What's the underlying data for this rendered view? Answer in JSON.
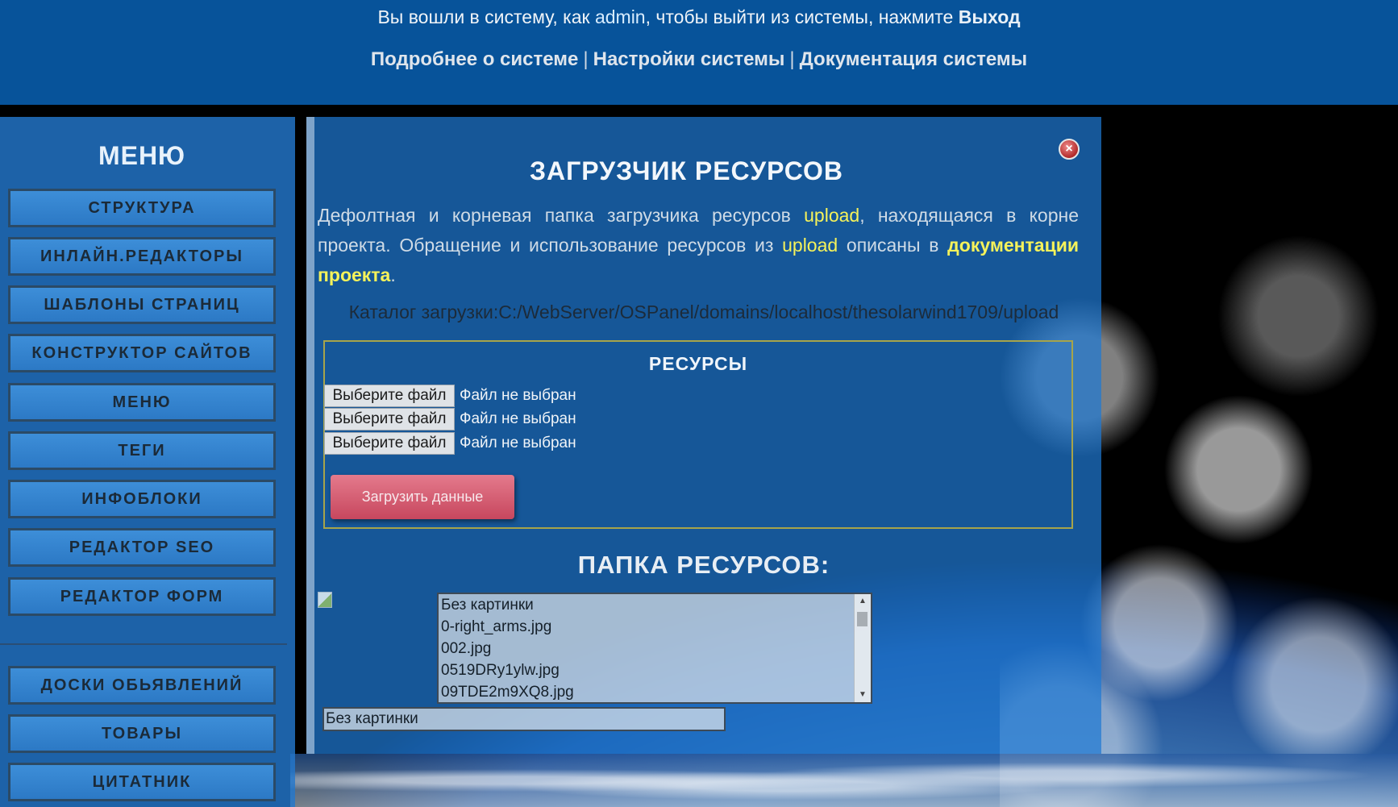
{
  "header": {
    "login_prefix": "Вы вошли в систему, как ",
    "user": "admin",
    "login_middle": ", чтобы выйти из системы, нажмите ",
    "exit_label": "Выход",
    "links": [
      "Подробнее о системе",
      "Настройки системы",
      "Документация системы"
    ],
    "separator": "|"
  },
  "sidebar": {
    "title": "МЕНЮ",
    "items": [
      "СТРУКТУРА",
      "ИНЛАЙН.РЕДАКТОРЫ",
      "ШАБЛОНЫ СТРАНИЦ",
      "КОНСТРУКТОР САЙТОВ",
      "МЕНЮ",
      "ТЕГИ",
      "ИНФОБЛОКИ",
      "РЕДАКТОР SEO",
      "РЕДАКТОР ФОРМ"
    ],
    "items_secondary": [
      "ДОСКИ ОБЬЯВЛЕНИЙ",
      "ТОВАРЫ",
      "ЦИТАТНИК"
    ]
  },
  "panel": {
    "title": "ЗАГРУЗЧИК РЕСУРСОВ",
    "close_icon": "close-icon",
    "intro": {
      "part1": "Дефолтная и корневая папка загрузчика ресурсов ",
      "hl1": "upload",
      "part2": ", находящаяся в корне проекта. Обращение и использование ресурсов из ",
      "hl2": "upload",
      "part3": " описаны в ",
      "link": "документации проекта",
      "part4": "."
    },
    "catalog_label": "Каталог загрузки:",
    "catalog_path": "C:/WebServer/OSPanel/domains/localhost/thesolarwind1709/upload",
    "resources_title": "РЕСУРСЫ",
    "file_inputs": [
      {
        "button": "Выберите файл",
        "status": "Файл не выбран"
      },
      {
        "button": "Выберите файл",
        "status": "Файл не выбран"
      },
      {
        "button": "Выберите файл",
        "status": "Файл не выбран"
      }
    ],
    "upload_button": "Загрузить данные",
    "folder_title": "ПАПКА РЕСУРСОВ:",
    "list_items": [
      "Без картинки",
      "0-right_arms.jpg",
      "002.jpg",
      "0519DRy1ylw.jpg",
      "09TDE2m9XQ8.jpg"
    ],
    "selected_value": "Без картинки"
  },
  "colors": {
    "header_bg": "#07539a",
    "highlight": "#f5f25a",
    "upload_button": "#c7475e"
  }
}
